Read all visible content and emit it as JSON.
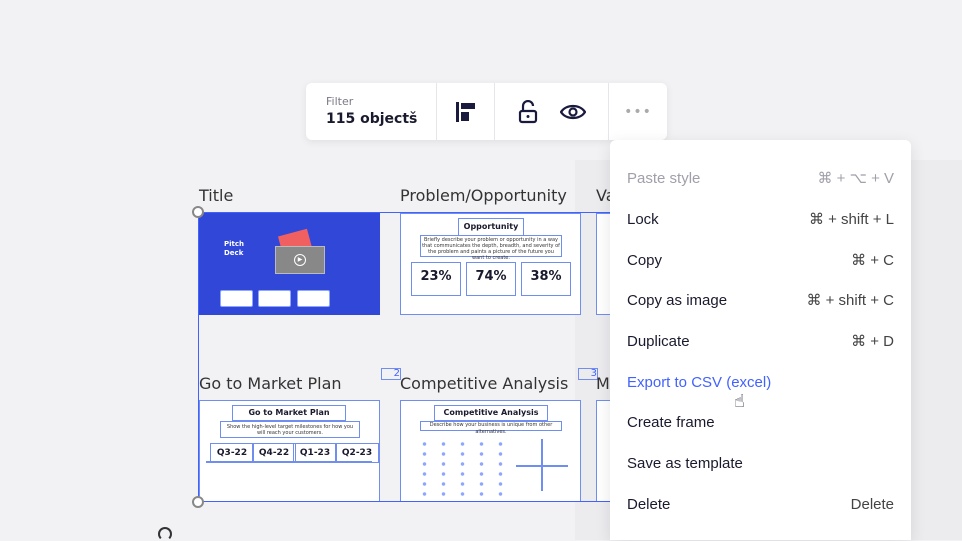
{
  "toolbar": {
    "filter_label": "Filter",
    "filter_value": "115 objects"
  },
  "frames": [
    {
      "label": "Title",
      "deck_title": "Pitch Deck"
    },
    {
      "label": "Problem/Opportunity",
      "heading": "Opportunity",
      "text": "Briefly describe your problem or opportunity in a way that communicates the depth, breadth, and severity of the problem and paints a picture of the future you want to create.",
      "stats": [
        "23%",
        "74%",
        "38%"
      ]
    },
    {
      "label": "Va"
    },
    {
      "label": "Go to Market Plan",
      "heading": "Go to Market Plan",
      "text": "Show the high-level target milestones for how you will reach your customers.",
      "quarters": [
        "Q3-22",
        "Q4-22",
        "Q1-23",
        "Q2-23"
      ],
      "badge": "2"
    },
    {
      "label": "Competitive Analysis",
      "heading": "Competitive Analysis",
      "text": "Describe how your business is unique from other alternatives.",
      "badge": "3"
    },
    {
      "label": "M"
    }
  ],
  "menu": [
    {
      "label": "Paste style",
      "shortcut": "⌘ + ⌥ + V",
      "state": "disabled"
    },
    {
      "label": "Lock",
      "shortcut": "⌘ + shift + L"
    },
    {
      "label": "Copy",
      "shortcut": "⌘ + C"
    },
    {
      "label": "Copy as image",
      "shortcut": "⌘ + shift + C"
    },
    {
      "label": "Duplicate",
      "shortcut": "⌘ + D"
    },
    {
      "label": "Export to CSV (excel)",
      "shortcut": "",
      "state": "hover"
    },
    {
      "label": "Create frame",
      "shortcut": ""
    },
    {
      "label": "Save as template",
      "shortcut": ""
    },
    {
      "label": "Delete",
      "shortcut": "Delete"
    }
  ],
  "colors": {
    "accent": "#4262ff",
    "title_slide": "#3047d8"
  }
}
